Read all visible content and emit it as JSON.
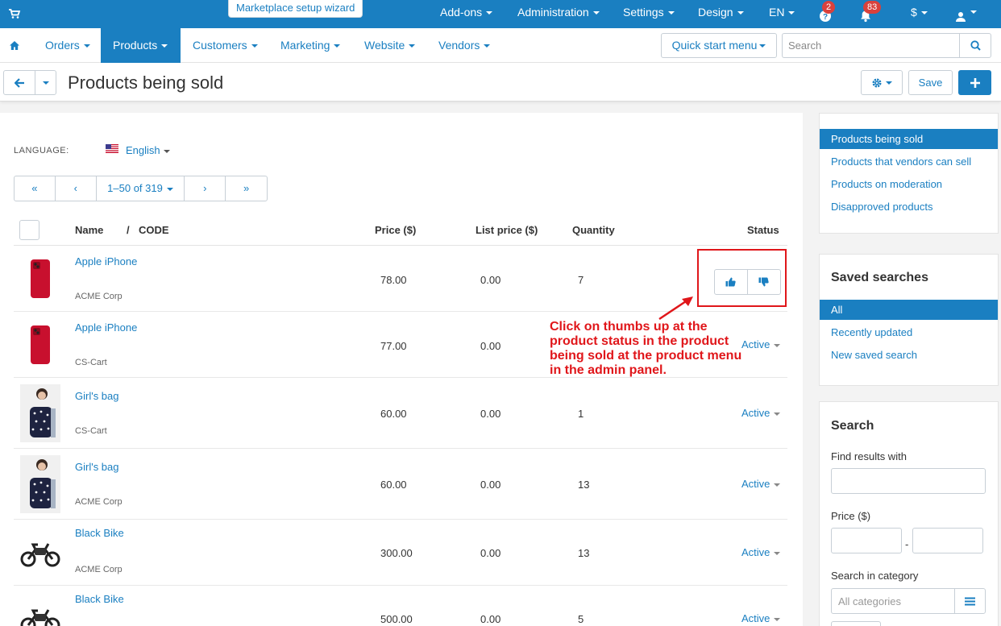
{
  "topbar": {
    "wizard_label": "Marketplace setup wizard",
    "addons": "Add-ons",
    "administration": "Administration",
    "settings": "Settings",
    "design": "Design",
    "language": "EN",
    "badge_help": "2",
    "badge_notifications": "83",
    "currency": "$"
  },
  "nav": {
    "orders": "Orders",
    "products": "Products",
    "customers": "Customers",
    "marketing": "Marketing",
    "website": "Website",
    "vendors": "Vendors",
    "quick_start": "Quick start menu",
    "search_placeholder": "Search"
  },
  "titlebar": {
    "title": "Products being sold",
    "save": "Save"
  },
  "main": {
    "language_label": "LANGUAGE:",
    "language_value": "English",
    "pager": {
      "first": "«",
      "prev": "‹",
      "range": "1–50 of 319",
      "next": "›",
      "last": "»"
    },
    "columns": {
      "name": "Name",
      "sep": "/",
      "code": "CODE",
      "price": "Price ($)",
      "list_price": "List price ($)",
      "quantity": "Quantity",
      "status": "Status"
    },
    "rows": [
      {
        "name": "Apple iPhone",
        "vendor": "ACME Corp",
        "price": "78.00",
        "list_price": "0.00",
        "quantity": "7",
        "status": "",
        "thumb": "phone"
      },
      {
        "name": "Apple iPhone",
        "vendor": "CS-Cart",
        "price": "77.00",
        "list_price": "0.00",
        "quantity": "",
        "status": "Active",
        "thumb": "phone"
      },
      {
        "name": "Girl's bag",
        "vendor": "CS-Cart",
        "price": "60.00",
        "list_price": "0.00",
        "quantity": "1",
        "status": "Active",
        "thumb": "bag"
      },
      {
        "name": "Girl's bag",
        "vendor": "ACME Corp",
        "price": "60.00",
        "list_price": "0.00",
        "quantity": "13",
        "status": "Active",
        "thumb": "bag"
      },
      {
        "name": "Black Bike",
        "vendor": "ACME Corp",
        "price": "300.00",
        "list_price": "0.00",
        "quantity": "13",
        "status": "Active",
        "thumb": "bike"
      },
      {
        "name": "Black Bike",
        "vendor": "",
        "price": "500.00",
        "list_price": "0.00",
        "quantity": "5",
        "status": "Active",
        "thumb": "bike"
      }
    ],
    "annotation": "Click on thumbs up at the product status in the product being sold at the product menu in the admin panel."
  },
  "sidebar": {
    "views": [
      "Products being sold",
      "Products that vendors can sell",
      "Products on moderation",
      "Disapproved products"
    ],
    "saved_title": "Saved searches",
    "saved": [
      "All",
      "Recently updated",
      "New saved search"
    ],
    "search_title": "Search",
    "find_label": "Find results with",
    "price_label": "Price ($)",
    "price_sep": "-",
    "category_label": "Search in category",
    "category_placeholder": "All categories"
  },
  "colors": {
    "accent": "#1a7fc1",
    "annotation": "#e0161a"
  }
}
